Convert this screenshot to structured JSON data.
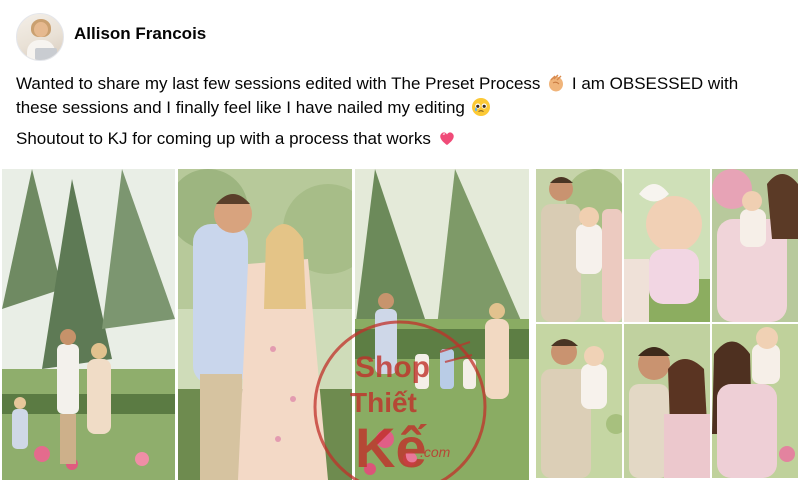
{
  "post": {
    "author": {
      "name": "Allison Francois"
    },
    "text": {
      "line1_part1": "Wanted to share my last few sessions edited with The Preset Process",
      "line1_part2": "I am OBSESSED with",
      "line2": "these sessions and I finally feel like I have nailed my editing",
      "line3": "Shoutout to KJ for coming up with a process that works"
    },
    "emojis": [
      "clapping-hands-emoji",
      "teary-face-emoji",
      "sparkling-heart-emoji"
    ]
  },
  "watermark": {
    "line1": "Shop",
    "line2": "Thiết",
    "line3": "Kế",
    "suffix": ".com"
  },
  "colors": {
    "text": "#050505",
    "watermark": "#c0302a"
  }
}
